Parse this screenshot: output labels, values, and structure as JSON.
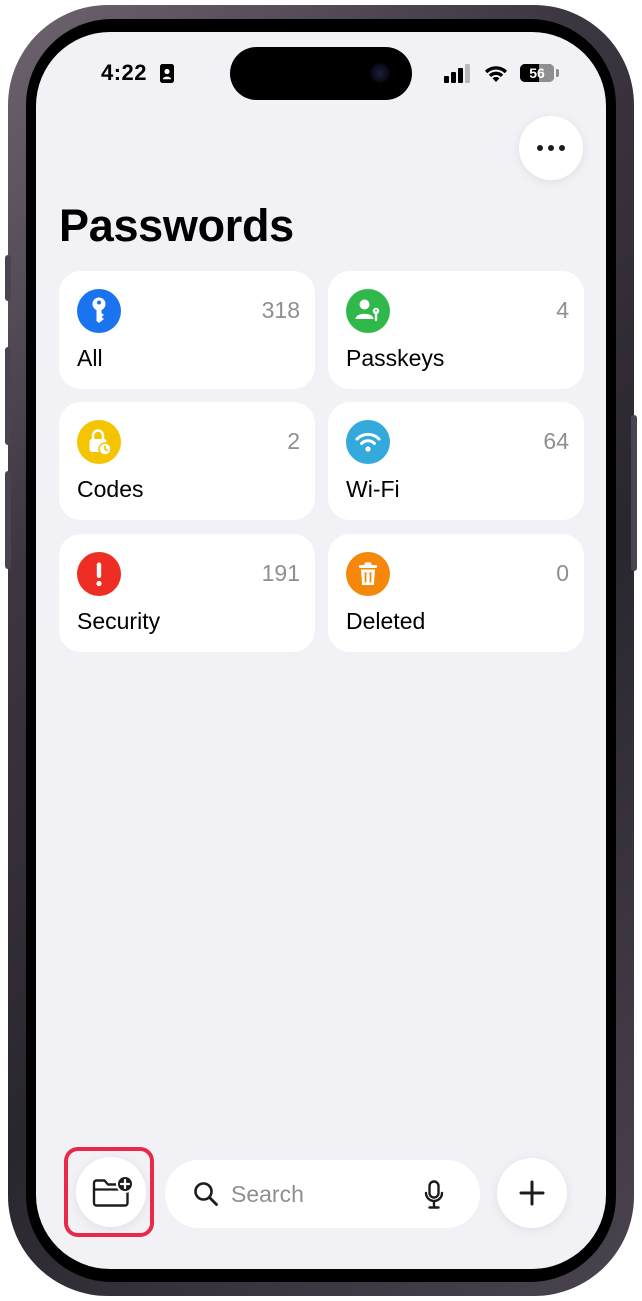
{
  "status": {
    "time": "4:22",
    "battery": "56",
    "battery_level": 0.56
  },
  "header": {
    "title": "Passwords",
    "more_icon": "ellipsis-icon"
  },
  "categories": [
    {
      "label": "All",
      "count": "318",
      "icon": "key-icon",
      "color": "#1a74f0"
    },
    {
      "label": "Passkeys",
      "count": "4",
      "icon": "person-key-icon",
      "color": "#30b94a"
    },
    {
      "label": "Codes",
      "count": "2",
      "icon": "lock-clock-icon",
      "color": "#f5c400"
    },
    {
      "label": "Wi-Fi",
      "count": "64",
      "icon": "wifi-icon",
      "color": "#34aadc"
    },
    {
      "label": "Security",
      "count": "191",
      "icon": "exclamation-icon",
      "color": "#ee2e24"
    },
    {
      "label": "Deleted",
      "count": "0",
      "icon": "trash-icon",
      "color": "#f5870a"
    }
  ],
  "toolbar": {
    "search_placeholder": "Search",
    "new_folder_icon": "folder-plus-icon",
    "add_icon": "plus-icon"
  },
  "colors": {
    "background": "#f2f1f6",
    "highlight": "#e8294a"
  }
}
